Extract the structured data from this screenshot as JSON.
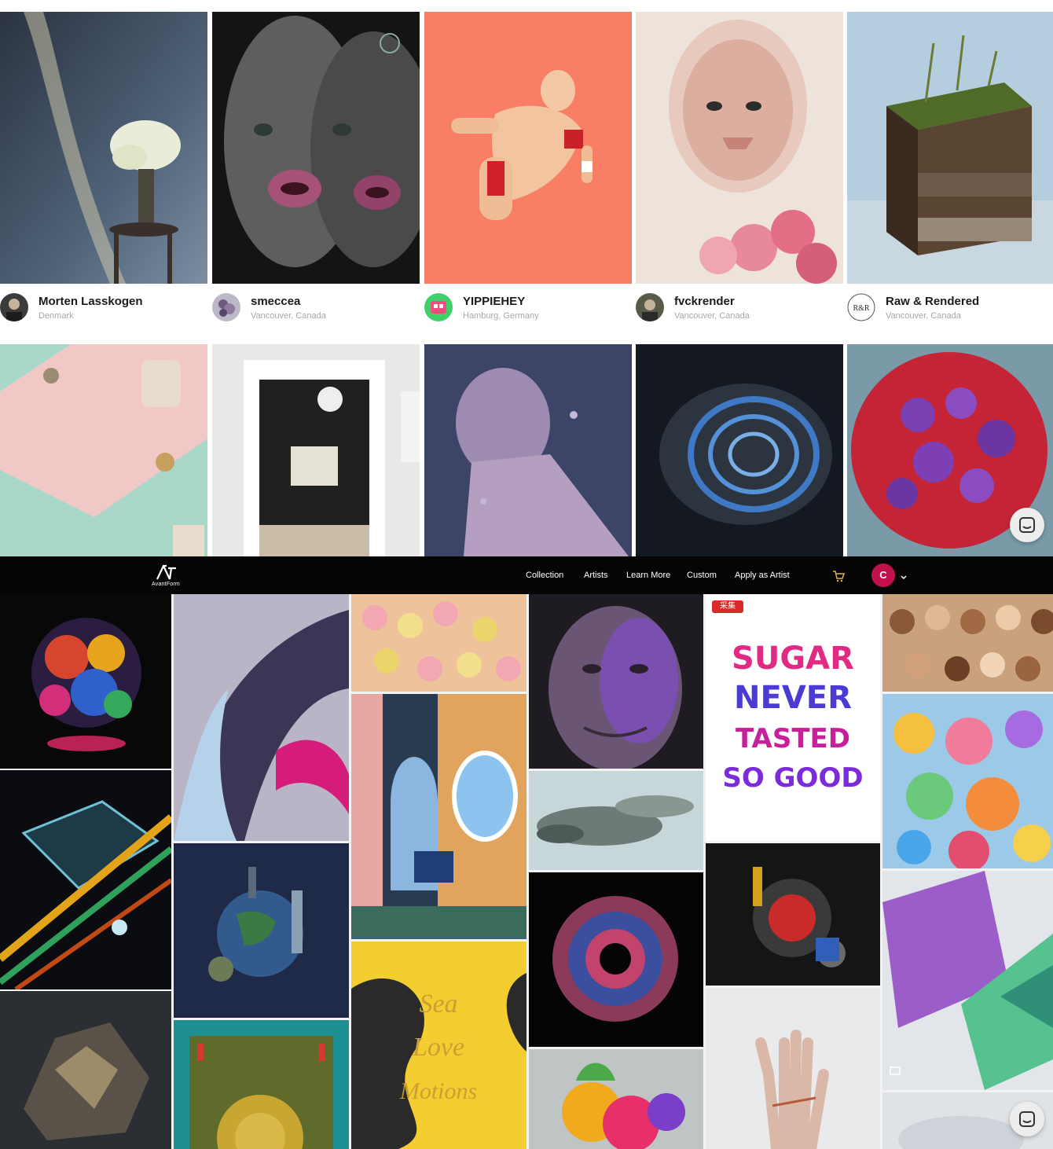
{
  "artists": [
    {
      "name": "Morten Lasskogen",
      "location": "Denmark"
    },
    {
      "name": "smeccea",
      "location": "Vancouver, Canada"
    },
    {
      "name": "YIPPIEHEY",
      "location": "Hamburg, Germany"
    },
    {
      "name": "fvckrender",
      "location": "Vancouver, Canada"
    },
    {
      "name": "Raw & Rendered",
      "location": "Vancouver, Canada"
    }
  ],
  "brand": {
    "name": "AvantForm",
    "badge_text": "R&R"
  },
  "nav": {
    "items": [
      "Collection",
      "Artists",
      "Learn More",
      "Custom",
      "Apply as Artist"
    ],
    "user_initial": "C"
  },
  "gallery": {
    "sugar_lines": [
      "SUGAR",
      "NEVER",
      "TASTED",
      "SO GOOD"
    ],
    "ribbon_lines": [
      "Sea",
      "Love",
      "Motions"
    ],
    "collect_badge": "采集"
  },
  "colors": {
    "header_bg": "#050505",
    "avatar_bg": "#c1104b",
    "accent_gold": "#c9a034"
  }
}
